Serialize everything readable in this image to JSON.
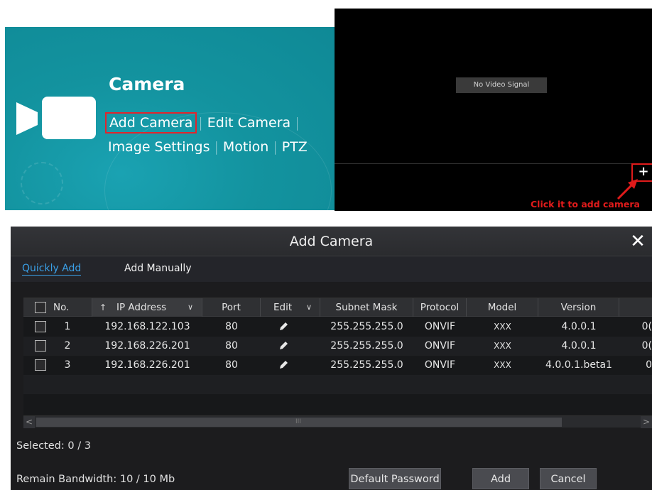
{
  "tile": {
    "title": "Camera",
    "links_row1": [
      "Add Camera",
      "Edit Camera"
    ],
    "links_row2": [
      "Image Settings",
      "Motion",
      "PTZ"
    ],
    "separator": "|",
    "highlight_color": "#e2242c",
    "background_color": "#13939f",
    "icon": "video-camera-icon"
  },
  "video": {
    "no_signal": "No Video Signal",
    "plus_label": "+",
    "hint": "Click it to add camera",
    "hint_color": "#e01b1b"
  },
  "dialog": {
    "title": "Add Camera",
    "close_label": "✕",
    "tabs": [
      {
        "label": "Quickly Add",
        "active": true
      },
      {
        "label": "Add Manually",
        "active": false
      }
    ],
    "accent_color": "#3aa0e8",
    "columns": {
      "no": "No.",
      "ip": "IP Address",
      "port": "Port",
      "edit": "Edit",
      "subnet": "Subnet Mask",
      "protocol": "Protocol",
      "model": "Model",
      "version": "Version",
      "sort_arrow": "↑"
    },
    "rows": [
      {
        "no": "1",
        "ip": "192.168.122.103",
        "port": "80",
        "subnet": "255.255.255.0",
        "protocol": "ONVIF",
        "model": "XXX",
        "version": "4.0.0.1",
        "extra": "0("
      },
      {
        "no": "2",
        "ip": "192.168.226.201",
        "port": "80",
        "subnet": "255.255.255.0",
        "protocol": "ONVIF",
        "model": "XXX",
        "version": "4.0.0.1",
        "extra": "0("
      },
      {
        "no": "3",
        "ip": "192.168.226.201",
        "port": "80",
        "subnet": "255.255.255.0",
        "protocol": "ONVIF",
        "model": "XXX",
        "version": "4.0.0.1.beta1",
        "extra": "0"
      }
    ],
    "scroll": {
      "left": "<",
      "right": ">",
      "grip": "III"
    },
    "selected_label": "Selected:",
    "selected_value": "0 / 3",
    "bandwidth_label": "Remain Bandwidth:",
    "bandwidth_value": "10 / 10 Mb",
    "buttons": {
      "default_password": "Default Password",
      "add": "Add",
      "cancel": "Cancel"
    }
  }
}
